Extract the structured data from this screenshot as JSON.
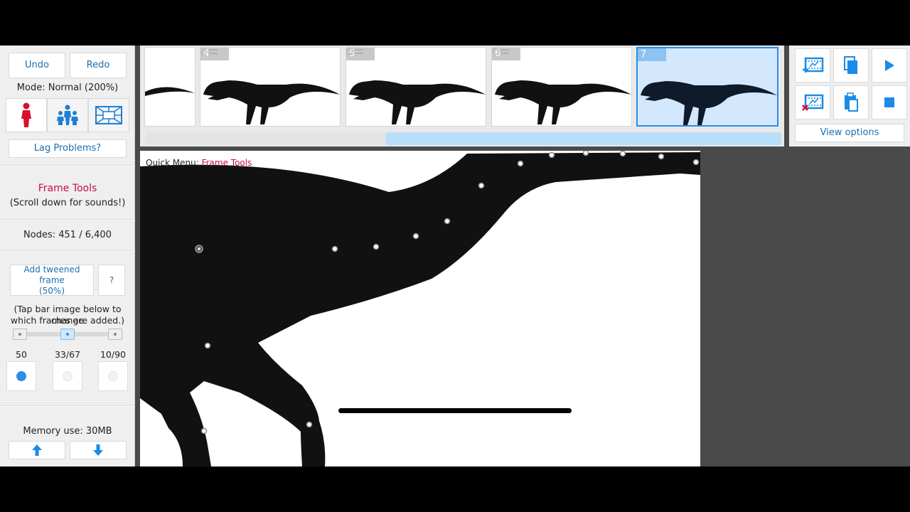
{
  "left_panel": {
    "undo_label": "Undo",
    "redo_label": "Redo",
    "mode_text": "Mode: Normal (200%)",
    "mode_icons": [
      "figure-icon",
      "group-icon",
      "scene-icon"
    ],
    "lag_label": "Lag Problems?",
    "section_title": "Frame Tools",
    "section_subtitle": "(Scroll down for sounds!)",
    "nodes_text": "Nodes: 451 / 6,400",
    "add_tween_label": "Add tweened frame",
    "add_tween_pct": "(50%)",
    "help_label": "?",
    "hint_line1": "(Tap bar image below to change",
    "hint_line2": "which frames are added.)",
    "tween_options": [
      {
        "label": "50",
        "selected": true
      },
      {
        "label": "33/67",
        "selected": false
      },
      {
        "label": "10/90",
        "selected": false
      }
    ],
    "memory_text": "Memory use: 30MB"
  },
  "timeline": {
    "frames": [
      {
        "number": "",
        "partial": true
      },
      {
        "number": "4"
      },
      {
        "number": "5"
      },
      {
        "number": "6"
      },
      {
        "number": "7",
        "selected": true
      }
    ],
    "scroll_position": 0.38
  },
  "right_panel": {
    "tool_icons": [
      "add-frame-icon",
      "copy-icon",
      "play-icon",
      "delete-frame-icon",
      "paste-icon",
      "stop-icon"
    ],
    "view_options_label": "View options",
    "accent": "#1b8be6"
  },
  "canvas": {
    "quick_menu_prefix": "Quick Menu:",
    "quick_menu_item": "Frame Tools"
  },
  "colors": {
    "accent_blue": "#1d6fb0",
    "title_red": "#c40d4a",
    "selected_frame": "#d3e8fd",
    "silhouette": "#111111"
  }
}
